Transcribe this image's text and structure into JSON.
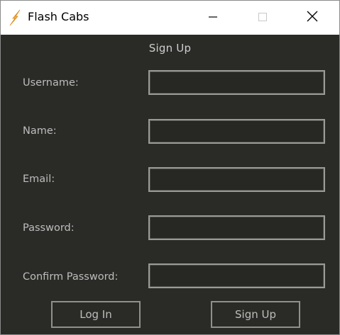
{
  "window": {
    "title": "Flash Cabs",
    "icon": "lightning-bolt-icon",
    "controls": {
      "minimize_icon": "minimize-icon",
      "maximize_icon": "maximize-icon",
      "close_icon": "close-icon"
    }
  },
  "form": {
    "heading": "Sign Up",
    "fields": [
      {
        "label": "Username:",
        "value": ""
      },
      {
        "label": "Name:",
        "value": ""
      },
      {
        "label": "Email:",
        "value": ""
      },
      {
        "label": "Password:",
        "value": ""
      },
      {
        "label": "Confirm Password:",
        "value": ""
      }
    ],
    "buttons": {
      "login_label": "Log In",
      "signup_label": "Sign Up"
    }
  },
  "colors": {
    "background": "#2a2a27",
    "text": "#bdbdbd",
    "border": "#9a9a96",
    "titlebar": "#ffffff",
    "icon_bolt": "#f2b134"
  }
}
